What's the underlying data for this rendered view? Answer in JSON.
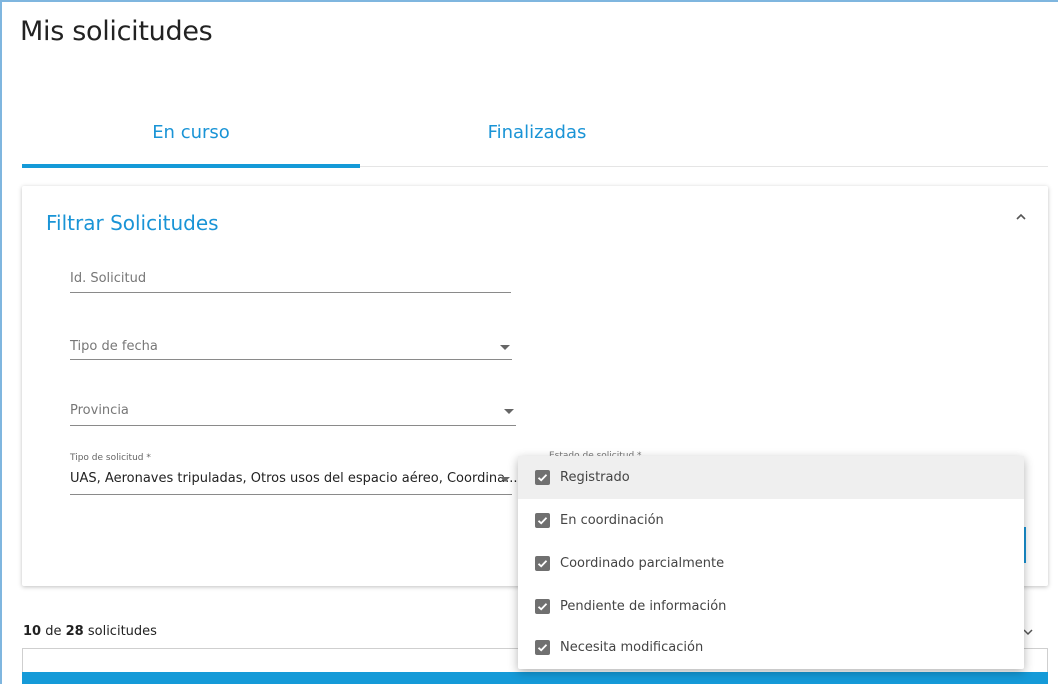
{
  "page_title": "Mis solicitudes",
  "tabs": [
    {
      "label": "En curso",
      "active": true
    },
    {
      "label": "Finalizadas",
      "active": false
    }
  ],
  "filter": {
    "title": "Filtrar Solicitudes",
    "id_placeholder": "Id. Solicitud",
    "tipo_fecha_placeholder": "Tipo de fecha",
    "provincia_placeholder": "Provincia",
    "tipo_solicitud_label": "Tipo de solicitud *",
    "tipo_solicitud_value": "UAS, Aeronaves tripuladas, Otros usos del espacio aéreo, Coordina...",
    "estado_label": "Estado de solicitud *"
  },
  "dropdown": {
    "options": [
      {
        "label": "Registrado",
        "checked": true
      },
      {
        "label": "En coordinación",
        "checked": true
      },
      {
        "label": "Coordinado parcialmente",
        "checked": true
      },
      {
        "label": "Pendiente de información",
        "checked": true
      },
      {
        "label": "Necesita modificación",
        "checked": true
      }
    ]
  },
  "results": {
    "shown": "10",
    "connector": "de",
    "total": "28",
    "suffix": "solicitudes"
  },
  "colors": {
    "accent": "#1a94d6",
    "checkbox": "#707070"
  },
  "icons": {
    "collapse": "chevron-up-icon",
    "dropdown_arrow": "caret-down-icon",
    "check": "check-icon"
  }
}
